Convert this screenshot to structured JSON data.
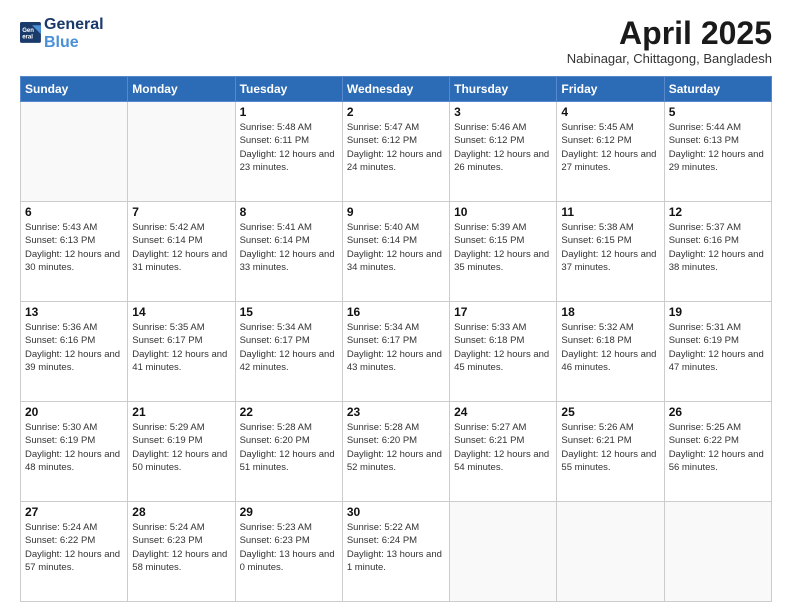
{
  "header": {
    "logo_line1": "General",
    "logo_line2": "Blue",
    "month_title": "April 2025",
    "location": "Nabinagar, Chittagong, Bangladesh"
  },
  "days_of_week": [
    "Sunday",
    "Monday",
    "Tuesday",
    "Wednesday",
    "Thursday",
    "Friday",
    "Saturday"
  ],
  "weeks": [
    [
      {
        "day": "",
        "info": ""
      },
      {
        "day": "",
        "info": ""
      },
      {
        "day": "1",
        "info": "Sunrise: 5:48 AM\nSunset: 6:11 PM\nDaylight: 12 hours and 23 minutes."
      },
      {
        "day": "2",
        "info": "Sunrise: 5:47 AM\nSunset: 6:12 PM\nDaylight: 12 hours and 24 minutes."
      },
      {
        "day": "3",
        "info": "Sunrise: 5:46 AM\nSunset: 6:12 PM\nDaylight: 12 hours and 26 minutes."
      },
      {
        "day": "4",
        "info": "Sunrise: 5:45 AM\nSunset: 6:12 PM\nDaylight: 12 hours and 27 minutes."
      },
      {
        "day": "5",
        "info": "Sunrise: 5:44 AM\nSunset: 6:13 PM\nDaylight: 12 hours and 29 minutes."
      }
    ],
    [
      {
        "day": "6",
        "info": "Sunrise: 5:43 AM\nSunset: 6:13 PM\nDaylight: 12 hours and 30 minutes."
      },
      {
        "day": "7",
        "info": "Sunrise: 5:42 AM\nSunset: 6:14 PM\nDaylight: 12 hours and 31 minutes."
      },
      {
        "day": "8",
        "info": "Sunrise: 5:41 AM\nSunset: 6:14 PM\nDaylight: 12 hours and 33 minutes."
      },
      {
        "day": "9",
        "info": "Sunrise: 5:40 AM\nSunset: 6:14 PM\nDaylight: 12 hours and 34 minutes."
      },
      {
        "day": "10",
        "info": "Sunrise: 5:39 AM\nSunset: 6:15 PM\nDaylight: 12 hours and 35 minutes."
      },
      {
        "day": "11",
        "info": "Sunrise: 5:38 AM\nSunset: 6:15 PM\nDaylight: 12 hours and 37 minutes."
      },
      {
        "day": "12",
        "info": "Sunrise: 5:37 AM\nSunset: 6:16 PM\nDaylight: 12 hours and 38 minutes."
      }
    ],
    [
      {
        "day": "13",
        "info": "Sunrise: 5:36 AM\nSunset: 6:16 PM\nDaylight: 12 hours and 39 minutes."
      },
      {
        "day": "14",
        "info": "Sunrise: 5:35 AM\nSunset: 6:17 PM\nDaylight: 12 hours and 41 minutes."
      },
      {
        "day": "15",
        "info": "Sunrise: 5:34 AM\nSunset: 6:17 PM\nDaylight: 12 hours and 42 minutes."
      },
      {
        "day": "16",
        "info": "Sunrise: 5:34 AM\nSunset: 6:17 PM\nDaylight: 12 hours and 43 minutes."
      },
      {
        "day": "17",
        "info": "Sunrise: 5:33 AM\nSunset: 6:18 PM\nDaylight: 12 hours and 45 minutes."
      },
      {
        "day": "18",
        "info": "Sunrise: 5:32 AM\nSunset: 6:18 PM\nDaylight: 12 hours and 46 minutes."
      },
      {
        "day": "19",
        "info": "Sunrise: 5:31 AM\nSunset: 6:19 PM\nDaylight: 12 hours and 47 minutes."
      }
    ],
    [
      {
        "day": "20",
        "info": "Sunrise: 5:30 AM\nSunset: 6:19 PM\nDaylight: 12 hours and 48 minutes."
      },
      {
        "day": "21",
        "info": "Sunrise: 5:29 AM\nSunset: 6:19 PM\nDaylight: 12 hours and 50 minutes."
      },
      {
        "day": "22",
        "info": "Sunrise: 5:28 AM\nSunset: 6:20 PM\nDaylight: 12 hours and 51 minutes."
      },
      {
        "day": "23",
        "info": "Sunrise: 5:28 AM\nSunset: 6:20 PM\nDaylight: 12 hours and 52 minutes."
      },
      {
        "day": "24",
        "info": "Sunrise: 5:27 AM\nSunset: 6:21 PM\nDaylight: 12 hours and 54 minutes."
      },
      {
        "day": "25",
        "info": "Sunrise: 5:26 AM\nSunset: 6:21 PM\nDaylight: 12 hours and 55 minutes."
      },
      {
        "day": "26",
        "info": "Sunrise: 5:25 AM\nSunset: 6:22 PM\nDaylight: 12 hours and 56 minutes."
      }
    ],
    [
      {
        "day": "27",
        "info": "Sunrise: 5:24 AM\nSunset: 6:22 PM\nDaylight: 12 hours and 57 minutes."
      },
      {
        "day": "28",
        "info": "Sunrise: 5:24 AM\nSunset: 6:23 PM\nDaylight: 12 hours and 58 minutes."
      },
      {
        "day": "29",
        "info": "Sunrise: 5:23 AM\nSunset: 6:23 PM\nDaylight: 13 hours and 0 minutes."
      },
      {
        "day": "30",
        "info": "Sunrise: 5:22 AM\nSunset: 6:24 PM\nDaylight: 13 hours and 1 minute."
      },
      {
        "day": "",
        "info": ""
      },
      {
        "day": "",
        "info": ""
      },
      {
        "day": "",
        "info": ""
      }
    ]
  ]
}
